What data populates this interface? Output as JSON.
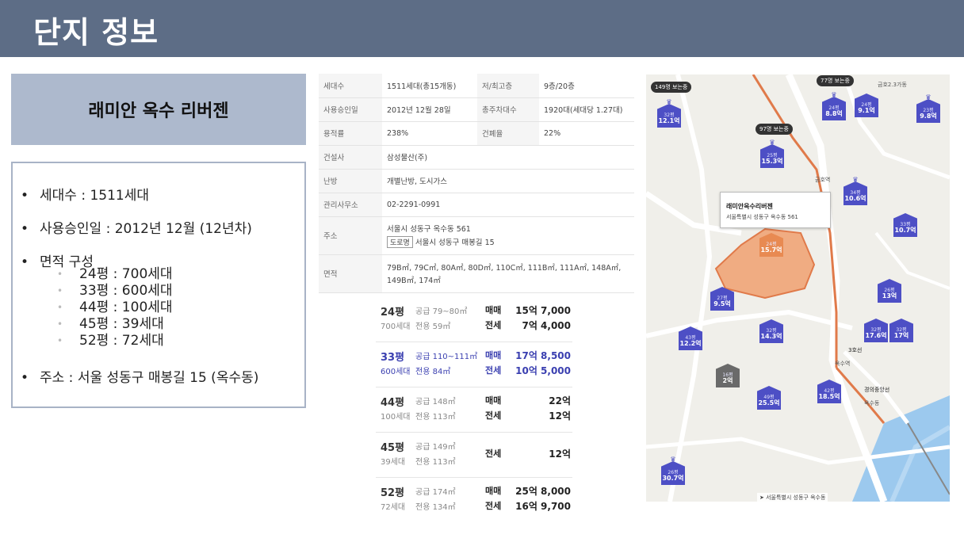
{
  "header": {
    "title": "단지 정보"
  },
  "complex": {
    "name": "래미안 옥수 리버젠"
  },
  "summary": {
    "households": "세대수 : 1511세대",
    "approval": "사용승인일 : 2012년 12월 (12년차)",
    "area_title": "면적 구성",
    "area_items": [
      "24평 : 700세대",
      "33평 : 600세대",
      "44평 : 100세대",
      "45평 : 39세대",
      "52평 : 72세대"
    ],
    "address": "주소 : 서울 성동구 매봉길 15 (옥수동)"
  },
  "info_table": {
    "r1": {
      "l1": "세대수",
      "v1": "1511세대(총15개동)",
      "l2": "저/최고층",
      "v2": "9층/20층"
    },
    "r2": {
      "l1": "사용승인일",
      "v1": "2012년 12월 28일",
      "l2": "총주차대수",
      "v2": "1920대(세대당 1.27대)"
    },
    "r3": {
      "l1": "용적률",
      "v1": "238%",
      "l2": "건폐율",
      "v2": "22%"
    },
    "r4": {
      "l1": "건설사",
      "v1": "삼성물산(주)"
    },
    "r5": {
      "l1": "난방",
      "v1": "개별난방, 도시가스"
    },
    "r6": {
      "l1": "관리사무소",
      "v1": "02-2291-0991"
    },
    "r7": {
      "l1": "주소",
      "v1": "서울시 성동구 옥수동 561",
      "tag": "도로명",
      "v2": "서울시 성동구 매봉길 15"
    },
    "r8": {
      "l1": "면적",
      "v1": "79B㎡, 79C㎡, 80A㎡, 80D㎡, 110C㎡, 111B㎡, 111A㎡, 148A㎡,",
      "v2": "149B㎡, 174㎡"
    }
  },
  "prices": [
    {
      "pyeong": "24평",
      "units": "700세대",
      "supply": "공급 79~80㎡",
      "exclusive": "전용 59㎡",
      "t1": "매매",
      "p1": "15억 7,000",
      "t2": "전세",
      "p2": "7억 4,000"
    },
    {
      "pyeong": "33평",
      "units": "600세대",
      "supply": "공급 110~111㎡",
      "exclusive": "전용 84㎡",
      "t1": "매매",
      "p1": "17억 8,500",
      "t2": "전세",
      "p2": "10억 5,000"
    },
    {
      "pyeong": "44평",
      "units": "100세대",
      "supply": "공급 148㎡",
      "exclusive": "전용 113㎡",
      "t1": "매매",
      "p1": "22억",
      "t2": "전세",
      "p2": "12억"
    },
    {
      "pyeong": "45평",
      "units": "39세대",
      "supply": "공급 149㎡",
      "exclusive": "전용 113㎡",
      "t2": "전세",
      "p2": "12억"
    },
    {
      "pyeong": "52평",
      "units": "72세대",
      "supply": "공급 174㎡",
      "exclusive": "전용 134㎡",
      "t1": "매매",
      "p1": "25억 8,000",
      "t2": "전세",
      "p2": "16억 9,700"
    }
  ],
  "map": {
    "labels": {
      "top_right": "금호2.3가동",
      "okhyeon": "금호역",
      "okso": "옥수역",
      "line3": "3호선",
      "gyeongui": "경의중앙선",
      "okso2": "옥수동"
    },
    "pills": {
      "p1": "149명 보는중",
      "p2": "77명 보는중",
      "p3": "97명 보는중"
    },
    "popup": {
      "name": "래미안옥수리버젠",
      "address": "서울특별시 성동구 옥수동 561"
    },
    "footer": "서울특별시 성동구 옥수동",
    "markers": [
      {
        "size": "32평",
        "price": "12.1억"
      },
      {
        "size": "24평",
        "price": "8.8억"
      },
      {
        "size": "24평",
        "price": "9.1억"
      },
      {
        "size": "23평",
        "price": "9.8억"
      },
      {
        "size": "25평",
        "price": "15.3억"
      },
      {
        "size": "34평",
        "price": "10.6억"
      },
      {
        "size": "24평",
        "price": "15.7억"
      },
      {
        "size": "33평",
        "price": "10.7억"
      },
      {
        "size": "26평",
        "price": "13억"
      },
      {
        "size": "27평",
        "price": "9.5억"
      },
      {
        "size": "43평",
        "price": "12.2억"
      },
      {
        "size": "32평",
        "price": "14.3억"
      },
      {
        "size": "32평",
        "price": "17.6억"
      },
      {
        "size": "32평",
        "price": "17억"
      },
      {
        "size": "16평",
        "price": "2억"
      },
      {
        "size": "49평",
        "price": "25.5억"
      },
      {
        "size": "42평",
        "price": "18.5억"
      },
      {
        "size": "26평",
        "price": "30.7억"
      }
    ]
  }
}
